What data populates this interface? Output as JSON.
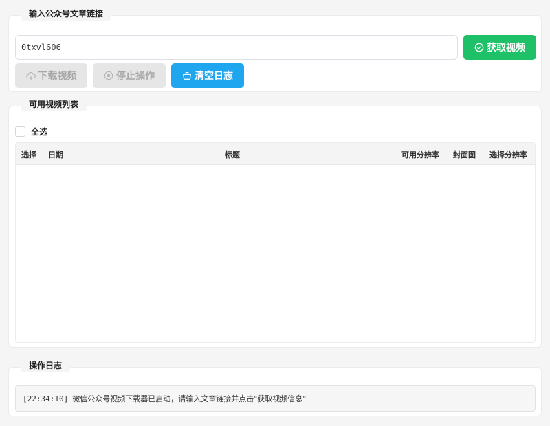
{
  "link_section": {
    "title": "输入公众号文章链接",
    "url_value": "0txvl606",
    "fetch_label": "获取视频",
    "download_label": "下载视频",
    "stop_label": "停止操作",
    "clear_label": "清空日志"
  },
  "list_section": {
    "title": "可用视频列表",
    "select_all_label": "全选",
    "columns": [
      "选择",
      "日期",
      "标题",
      "可用分辨率",
      "封面图",
      "选择分辨率"
    ],
    "rows": []
  },
  "log_section": {
    "title": "操作日志",
    "entries": [
      {
        "time": "[22:34:10]",
        "message": "微信公众号视频下载器已启动，请输入文章链接并点击\"获取视频信息\""
      }
    ]
  },
  "colors": {
    "fetch_button": "#1ec168",
    "clear_button": "#1fa6ef",
    "disabled_button": "#e6e6e6"
  }
}
